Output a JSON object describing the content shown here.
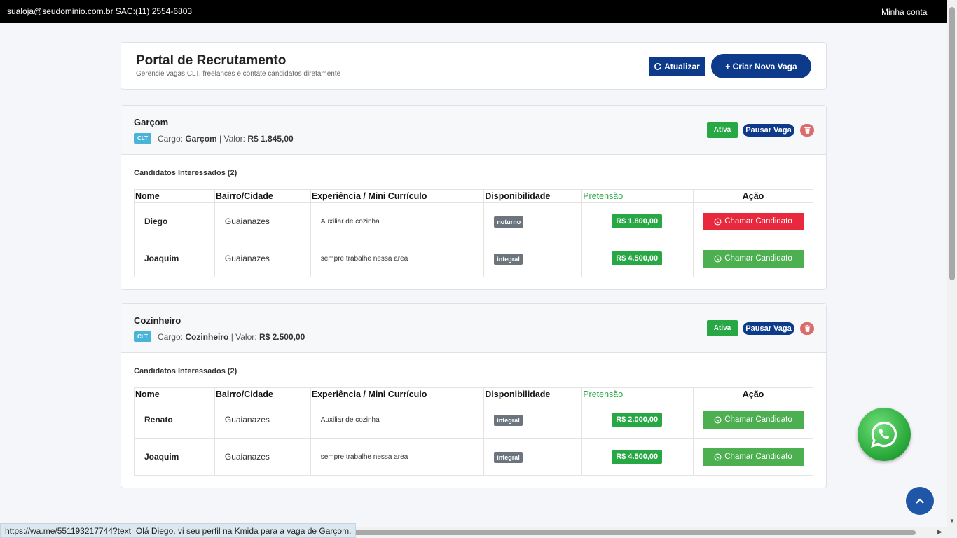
{
  "topbar": {
    "contact": "sualoja@seudominio.com.br SAC:(11) 2554-6803",
    "account": "Minha conta"
  },
  "header": {
    "title": "Portal de Recrutamento",
    "subtitle": "Gerencie vagas CLT, freelances e contate candidatos diretamente",
    "refresh_label": "Atualizar",
    "new_job_label": "+ Criar Nova Vaga"
  },
  "table_headers": [
    "Nome",
    "Bairro/Cidade",
    "Experiência / Mini Currículo",
    "Disponibilidade",
    "Pretensão",
    "Ação"
  ],
  "jobs": [
    {
      "title": "Garçom",
      "type": "CLT",
      "cargo_label": "Cargo:",
      "cargo": "Garçom",
      "valor_label": "| Valor:",
      "valor": "R$ 1.845,00",
      "status": "Ativa",
      "pause_label": "Pausar Vaga",
      "candidates_title": "Candidatos Interessados (2)",
      "candidates": [
        {
          "name": "Diego",
          "city": "Guaianazes",
          "experience": "Auxiliar de cozinha",
          "availability": "noturno",
          "pretension": "R$ 1.800,00",
          "action": "Chamar Candidato",
          "action_color": "#e8283c"
        },
        {
          "name": "Joaquim",
          "city": "Guaianazes",
          "experience": "sempre trabalhe nessa area",
          "availability": "integral",
          "pretension": "R$ 4.500,00",
          "action": "Chamar Candidato",
          "action_color": "#4caf50"
        }
      ]
    },
    {
      "title": "Cozinheiro",
      "type": "CLT",
      "cargo_label": "Cargo:",
      "cargo": "Cozinheiro",
      "valor_label": "| Valor:",
      "valor": "R$ 2.500,00",
      "status": "Ativa",
      "pause_label": "Pausar Vaga",
      "candidates_title": "Candidatos Interessados (2)",
      "candidates": [
        {
          "name": "Renato",
          "city": "Guaianazes",
          "experience": "Auxiliar de cozinha",
          "availability": "integral",
          "pretension": "R$ 2.000,00",
          "action": "Chamar Candidato",
          "action_color": "#4caf50"
        },
        {
          "name": "Joaquim",
          "city": "Guaianazes",
          "experience": "sempre trabalhe nessa area",
          "availability": "integral",
          "pretension": "R$ 4.500,00",
          "action": "Chamar Candidato",
          "action_color": "#4caf50"
        }
      ]
    }
  ],
  "status_url": "https://wa.me/551193217744?text=Olá Diego, vi seu perfil na Kmida para a vaga de Garçom.",
  "icons": {
    "refresh": "refresh-icon",
    "trash": "trash-icon",
    "whatsapp": "whatsapp-icon",
    "to_top": "chevron-up-icon"
  },
  "colors": {
    "primary": "#0d3a8a",
    "success": "#28a745",
    "danger": "#e8283c",
    "whatsapp": "#4caf50"
  }
}
